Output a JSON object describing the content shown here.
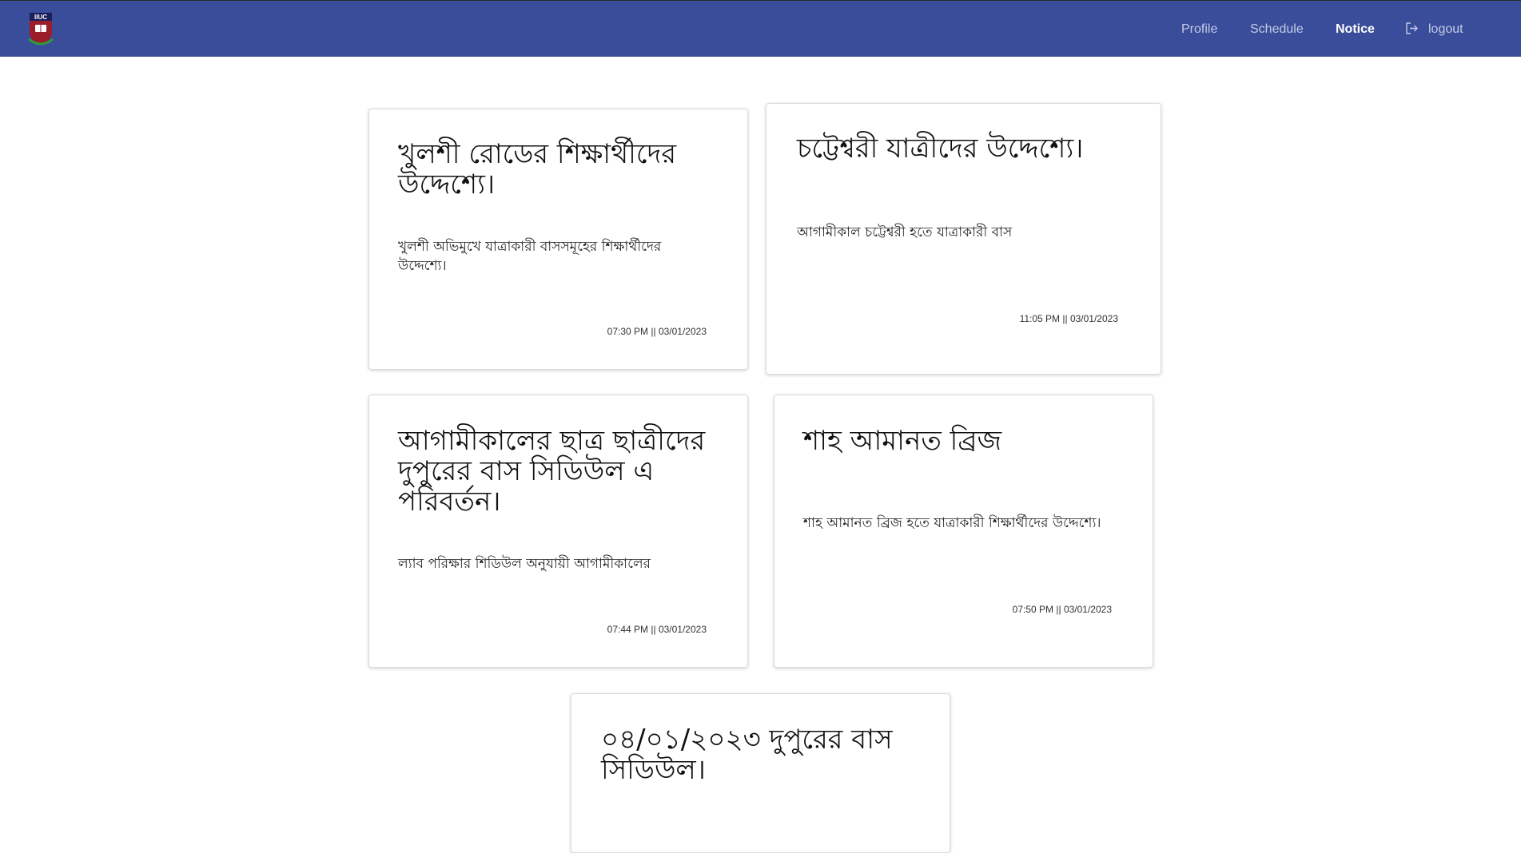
{
  "nav": {
    "links": [
      {
        "label": "Profile"
      },
      {
        "label": "Schedule"
      },
      {
        "label": "Notice"
      },
      {
        "label": "logout"
      }
    ],
    "logo_text": "IIUC",
    "colors": {
      "bar": "#3a4d9a",
      "link": "#c3cbe6",
      "active": "#ffffff"
    }
  },
  "notices": [
    {
      "title": "খুলশী রোডের শিক্ষার্থীদের উদ্দেশ্যে।",
      "body": "খুলশী অভিমুখে যাত্রাকারী বাসসমূহের শিক্ষার্থীদের উদ্দেশ্যে।",
      "time": "07:30 PM || 03/01/2023"
    },
    {
      "title": "চট্টেশ্বরী যাত্রীদের উদ্দেশ্যে।",
      "body": "আগামীকাল চট্টেশ্বরী হতে যাত্রাকারী বাস",
      "time": "11:05 PM || 03/01/2023"
    },
    {
      "title": "আগামীকালের ছাত্র ছাত্রীদের দুপুরের বাস সিডিউল এ পরিবর্তন।",
      "body": "ল্যাব পরিক্ষার শিডিউল অনুযায়ী আগামীকালের",
      "time": "07:44 PM || 03/01/2023"
    },
    {
      "title": "শাহ আমানত ব্রিজ",
      "body": "শাহ আমানত ব্রিজ হতে যাত্রাকারী শিক্ষার্থীদের উদ্দেশ্যে।",
      "time": "07:50 PM || 03/01/2023"
    },
    {
      "title": "০৪/০১/২০২৩ দুপুরের বাস সিডিউল।",
      "body": "",
      "time": ""
    }
  ]
}
